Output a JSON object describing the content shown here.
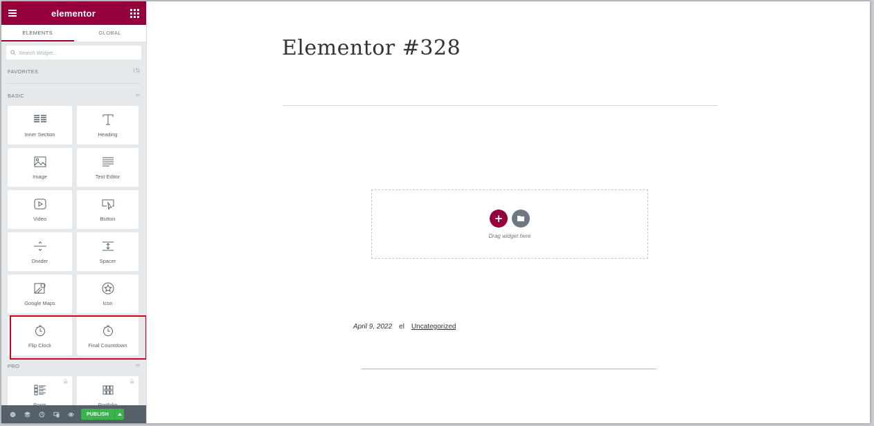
{
  "colors": {
    "brand": "#93003c",
    "publish": "#39b54a",
    "highlight": "#d6001c"
  },
  "topbar": {
    "brand": "elementor",
    "menu_icon": "hamburger-icon",
    "apps_icon": "grid-apps-icon"
  },
  "tabs": [
    {
      "label": "ELEMENTS",
      "active": true
    },
    {
      "label": "GLOBAL",
      "active": false
    }
  ],
  "search": {
    "placeholder": "Search Widget..."
  },
  "categories": {
    "favorites": {
      "label": "FAVORITES"
    },
    "basic": {
      "label": "BASIC"
    },
    "pro": {
      "label": "PRO"
    }
  },
  "widgets": [
    {
      "label": "Inner Section",
      "icon": "inner-section-icon"
    },
    {
      "label": "Heading",
      "icon": "heading-icon"
    },
    {
      "label": "Image",
      "icon": "image-icon"
    },
    {
      "label": "Text Editor",
      "icon": "text-editor-icon"
    },
    {
      "label": "Video",
      "icon": "video-icon"
    },
    {
      "label": "Button",
      "icon": "button-icon"
    },
    {
      "label": "Divider",
      "icon": "divider-icon"
    },
    {
      "label": "Spacer",
      "icon": "spacer-icon"
    },
    {
      "label": "Google Maps",
      "icon": "google-maps-icon"
    },
    {
      "label": "Icon",
      "icon": "star-icon"
    },
    {
      "label": "Flip Clock",
      "icon": "stopwatch-icon"
    },
    {
      "label": "Final Countdown",
      "icon": "stopwatch-icon"
    },
    {
      "label": "Posts",
      "icon": "posts-icon",
      "locked": true
    },
    {
      "label": "Portfolio",
      "icon": "portfolio-icon",
      "locked": true
    }
  ],
  "bottombar": {
    "publish_label": "PUBLISH"
  },
  "canvas": {
    "page_title": "Elementor #328",
    "drop_text": "Drag widget here",
    "post_date": "April 9, 2022",
    "post_author": "el",
    "post_category": "Uncategorized"
  }
}
